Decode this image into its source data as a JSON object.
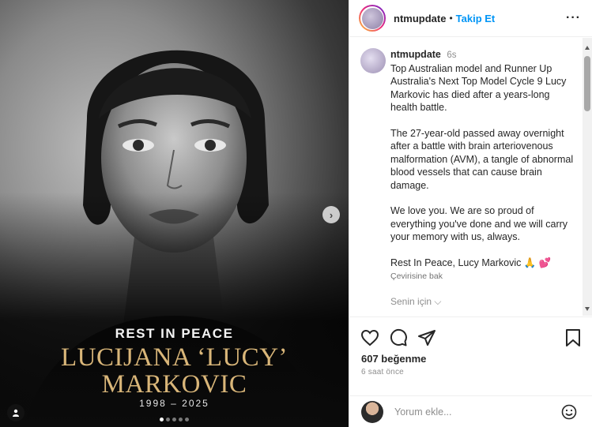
{
  "media": {
    "rest_in_peace": "REST IN PEACE",
    "name_line1": "LUCIJANA ‘LUCY’",
    "name_line2": "MARKOVIC",
    "years": "1998 – 2025",
    "next_symbol": "›",
    "carousel_dots": 5,
    "active_dot": 0,
    "name_color": "#d9b679"
  },
  "header": {
    "username": "ntmupdate",
    "separator": "•",
    "follow_label": "Takip Et",
    "more_symbol": "···",
    "follow_color": "#0095f6"
  },
  "caption": {
    "username": "ntmupdate",
    "time": "6s",
    "paragraph1": "Top Australian model and Runner Up Australia's Next Top Model Cycle 9 Lucy Markovic has died after a years-long health battle.",
    "paragraph2": "The 27-year-old passed away overnight after a battle with brain arteriovenous malformation (AVM), a tangle of abnormal blood vessels that can cause brain damage.",
    "paragraph3": "We love you. We are so proud of everything you've done and we will carry your memory with us, always.",
    "paragraph4": "Rest In Peace, Lucy Markovic 🙏 💕",
    "translate_label": "Çevirisine bak",
    "for_you_label": "Senin için ⌵"
  },
  "actions": {
    "likes": "607 beğenme",
    "time_ago": "6 saat önce"
  },
  "comment": {
    "placeholder": "Yorum ekle..."
  },
  "icons": [
    "heart-icon",
    "comment-icon",
    "share-icon",
    "bookmark-icon",
    "emoji-icon",
    "user-tag-icon",
    "more-icon"
  ]
}
